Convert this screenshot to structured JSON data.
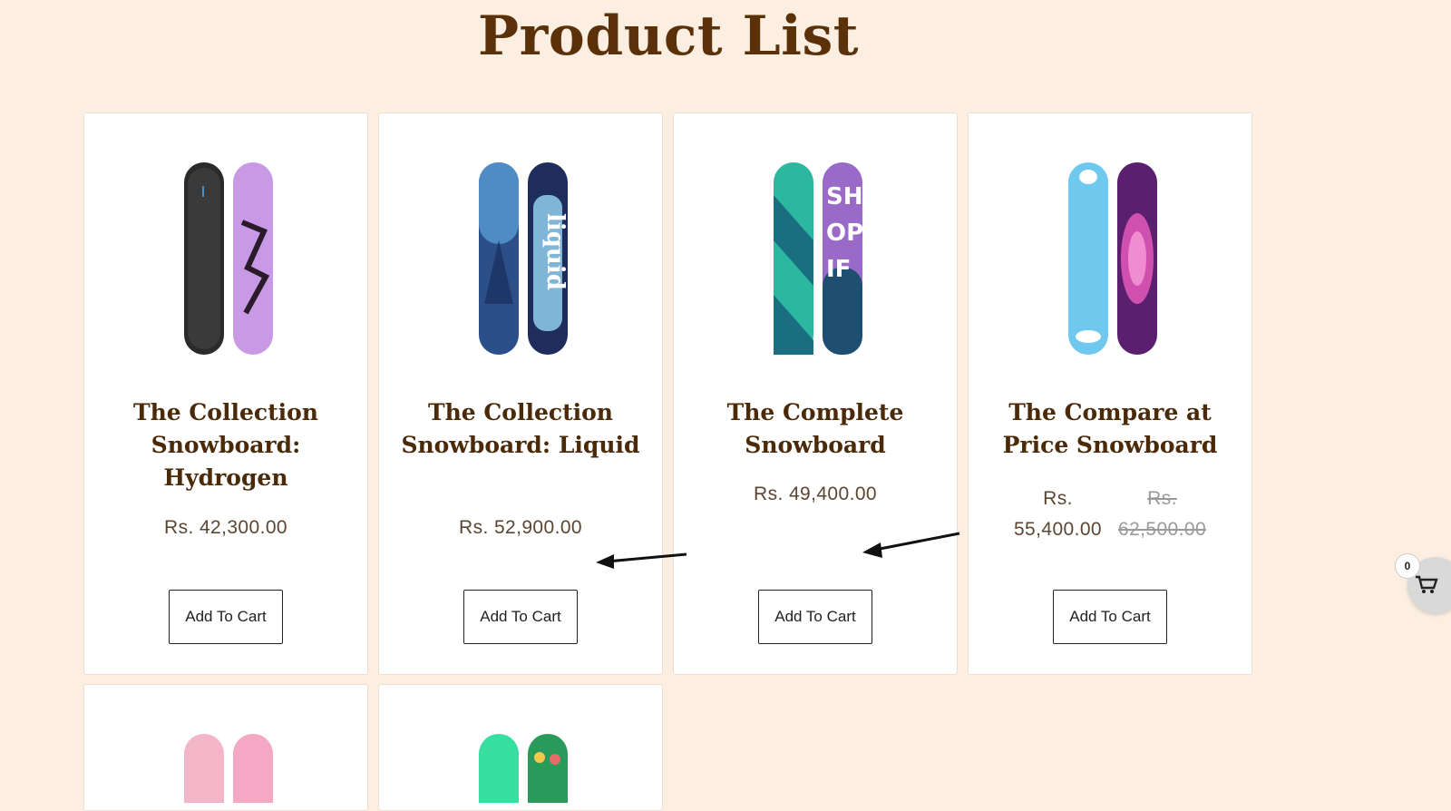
{
  "page": {
    "title": "Product List"
  },
  "products": [
    {
      "title": "The Collection Snowboard: Hydrogen",
      "price": "Rs. 42,300.00",
      "button": "Add To Cart"
    },
    {
      "title": "The Collection Snowboard: Liquid",
      "price": "Rs. 52,900.00",
      "button": "Add To Cart"
    },
    {
      "title": "The Complete Snowboard",
      "price": "Rs. 49,400.00",
      "button": "Add To Cart"
    },
    {
      "title": "The Compare at Price Snowboard",
      "price_line1": "Rs.",
      "price_line2": "55,400.00",
      "compare_line1": "Rs.",
      "compare_line2": "62,500.00",
      "button": "Add To Cart"
    }
  ],
  "cart": {
    "count": "0",
    "icon": "shopping-cart-icon"
  },
  "colors": {
    "background": "#fcefe2",
    "title": "#5a3108",
    "card": "#ffffff"
  }
}
